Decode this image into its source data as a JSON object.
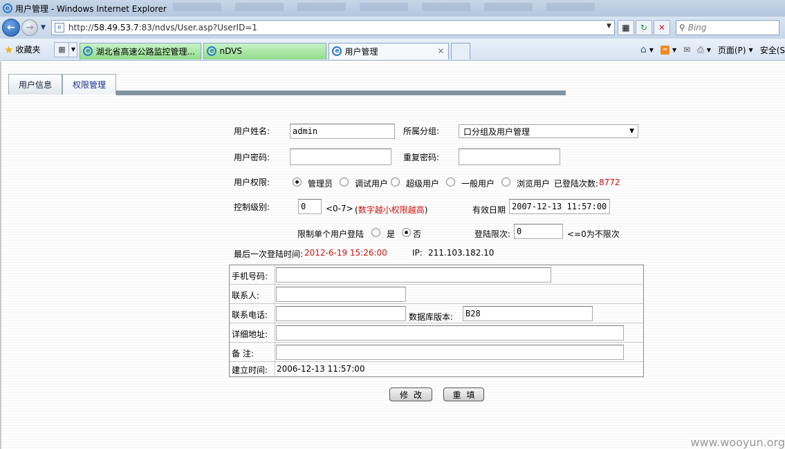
{
  "window": {
    "title": "用户管理 - Windows Internet Explorer"
  },
  "address": {
    "url_prefix": "http://",
    "url_host": "58.49.53.7",
    "url_rest": ":83/ndvs/User.asp?UserID=1",
    "search_placeholder": "Bing"
  },
  "favorites": {
    "label": "收藏夹"
  },
  "browser_tabs": [
    {
      "label": "湖北省高速公路监控管理..."
    },
    {
      "label": "nDVS"
    },
    {
      "label": "用户管理"
    }
  ],
  "command_bar": {
    "page_menu": "页面(P)",
    "safety_menu": "安全(S"
  },
  "page_tabs": [
    {
      "label": "用户信息"
    },
    {
      "label": "权限管理"
    }
  ],
  "form": {
    "username_label": "用户姓名:",
    "username_value": "admin",
    "group_label": "所属分组:",
    "group_value": "口分组及用户管理",
    "password_label": "用户密码:",
    "password_value": "",
    "repeat_password_label": "重复密码:",
    "repeat_password_value": "",
    "permission_label": "用户权限:",
    "roles": [
      "管理员",
      "调试用户",
      "超级用户",
      "一般用户",
      "浏览用户"
    ],
    "selected_role": "管理员",
    "login_count_label": "已登陆次数:",
    "login_count": "8772",
    "control_level_label": "控制级别:",
    "control_level_value": "0",
    "control_level_range": "<0-7>",
    "control_level_note_open": "(",
    "control_level_note": "数字越小权限越高",
    "control_level_note_close": ")",
    "valid_date_label": "有效日期",
    "valid_date_value": "2007-12-13 11:57:00",
    "single_login_label": "限制单个用户登陆",
    "single_login_yes": "是",
    "single_login_no": "否",
    "single_login_selected": "否",
    "login_limit_label": "登陆限次:",
    "login_limit_value": "0",
    "login_limit_note": "<=0为不限次",
    "last_login_label": "最后一次登陆时间:",
    "last_login_time": "2012-6-19 15:26:00",
    "ip_label": "IP:",
    "ip_value": "211.103.182.10"
  },
  "info_table": {
    "mobile_label": "手机号码:",
    "mobile_value": "",
    "contact_label": "联系人:",
    "contact_value": "",
    "phone_label": "联系电话:",
    "phone_value": "",
    "db_version_label": "数据库版本:",
    "db_version_value": "B28",
    "address_label": "详细地址:",
    "address_value": "",
    "note_label": "备 注:",
    "note_value": "",
    "created_label": "建立时间:",
    "created_value": "2006-12-13 11:57:00"
  },
  "buttons": {
    "modify": "修改",
    "reset": "重填"
  },
  "watermark": "www.wooyun.org"
}
